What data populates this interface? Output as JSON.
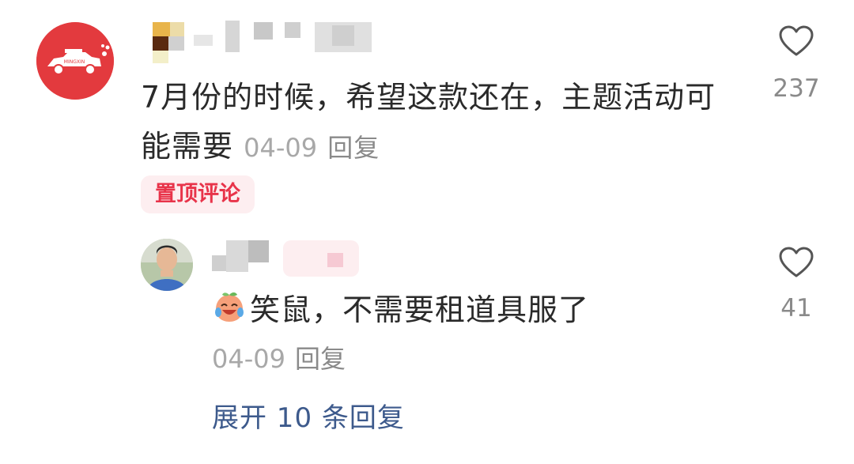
{
  "comment": {
    "text": "7月份的时候，希望这款还在，主题活动可能需要",
    "date": "04-09",
    "reply_label": "回复",
    "pinned_tag": "置顶评论",
    "like_count": "237",
    "avatar_logo_text": "MINGXIN"
  },
  "reply": {
    "emoji_icon": "crying-laughing-peach-emoji",
    "text": "笑鼠，不需要租道具服了",
    "date": "04-09",
    "reply_label": "回复",
    "like_count": "41"
  },
  "expand_label": "展开 10 条回复",
  "colors": {
    "pinned_tag_text": "#e8344a",
    "pinned_tag_bg": "#fdeef0",
    "link_blue": "#3d5a8c",
    "avatar_red": "#e33a3e"
  }
}
